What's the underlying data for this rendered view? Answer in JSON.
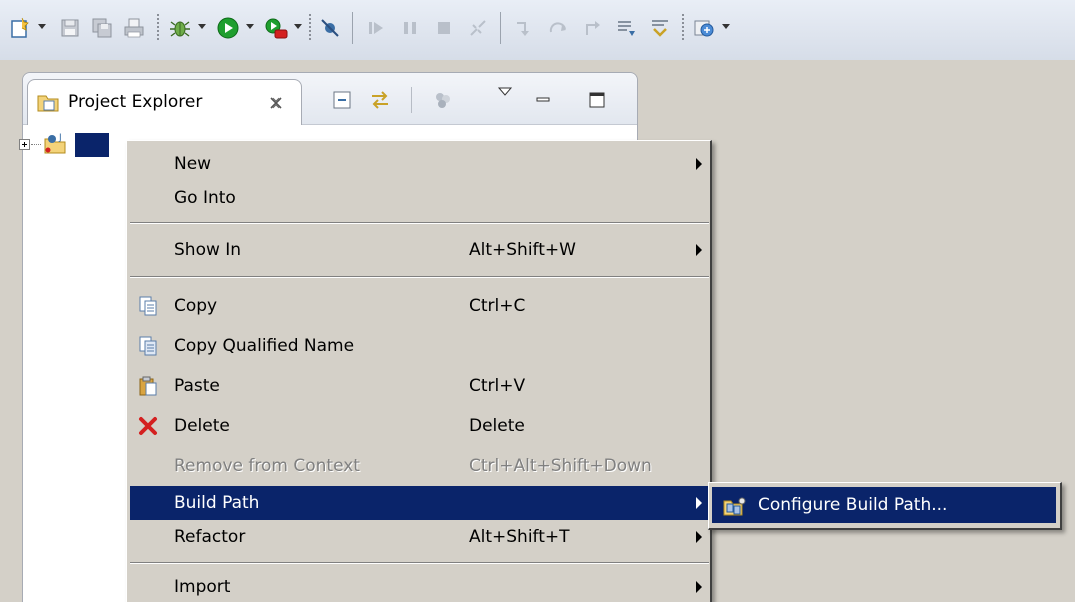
{
  "explorer": {
    "tab_title": "Project Explorer"
  },
  "tree": {
    "project_label": ""
  },
  "context_menu": {
    "items": [
      {
        "label": "New",
        "shortcut": "",
        "has_submenu": true
      },
      {
        "label": "Go Into",
        "shortcut": "",
        "has_submenu": false
      },
      {
        "label": "Show In",
        "shortcut": "Alt+Shift+W",
        "has_submenu": true
      },
      {
        "label": "Copy",
        "shortcut": "Ctrl+C",
        "icon": "copy-icon"
      },
      {
        "label": "Copy Qualified Name",
        "shortcut": "",
        "icon": "copy-qualified-name-icon"
      },
      {
        "label": "Paste",
        "shortcut": "Ctrl+V",
        "icon": "paste-icon"
      },
      {
        "label": "Delete",
        "shortcut": "Delete",
        "icon": "delete-icon"
      },
      {
        "label": "Remove from Context",
        "shortcut": "Ctrl+Alt+Shift+Down",
        "disabled": true
      },
      {
        "label": "Build Path",
        "shortcut": "",
        "has_submenu": true,
        "highlighted": true
      },
      {
        "label": "Refactor",
        "shortcut": "Alt+Shift+T",
        "has_submenu": true
      },
      {
        "label": "Import",
        "shortcut": "",
        "has_submenu": true
      }
    ]
  },
  "submenu": {
    "items": [
      {
        "label": "Configure Build Path...",
        "icon": "configure-build-path-icon",
        "highlighted": true
      }
    ]
  },
  "colors": {
    "highlight": "#0a246a",
    "menu_background": "#d4d0c8",
    "toolbar_background": "#dde3ec",
    "delete_red": "#d42020",
    "run_green": "#1e9e2e"
  }
}
